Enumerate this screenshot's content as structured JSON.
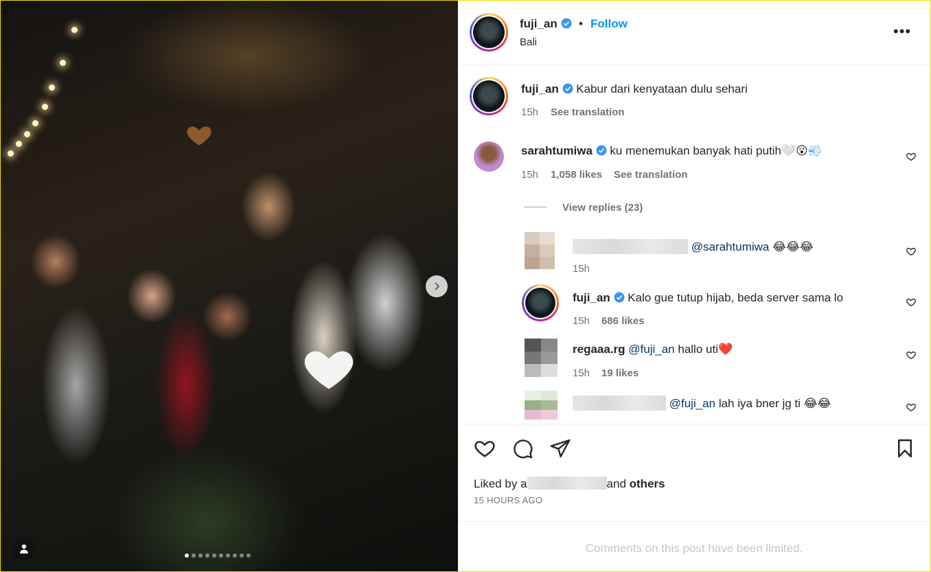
{
  "post": {
    "username": "fuji_an",
    "follow_label": "Follow",
    "separator": "•",
    "location": "Bali",
    "more_label": "•••"
  },
  "caption": {
    "username": "fuji_an",
    "text": "Kabur dari kenyataan dulu sehari",
    "time": "15h",
    "translate": "See translation"
  },
  "comments": [
    {
      "username": "sarahtumiwa",
      "text": "ku menemukan banyak hati putih🤍😮💨",
      "time": "15h",
      "likes": "1,058 likes",
      "translate": "See translation",
      "view_replies": "View replies (23)"
    }
  ],
  "replies": [
    {
      "mention": "@sarahtumiwa",
      "text": "😂😂😂",
      "time": "15h"
    },
    {
      "username": "fuji_an",
      "text": "Kalo gue tutup hijab, beda server sama lo",
      "time": "15h",
      "likes": "686 likes"
    },
    {
      "username": "regaaa.rg",
      "mention": "@fuji_an",
      "text": "hallo uti❤️",
      "time": "15h",
      "likes": "19 likes"
    },
    {
      "mention": "@fuji_an",
      "text": "lah iya bner jg ti 😂😂"
    }
  ],
  "footer": {
    "liked_prefix": "Liked by",
    "liked_partial": "a",
    "liked_mid": "and",
    "liked_others": "others",
    "time_ago": "15 HOURS AGO",
    "limited": "Comments on this post have been limited."
  },
  "carousel": {
    "total_dots": 10,
    "active_index": 0
  },
  "colors": {
    "accent": "#0095f6",
    "mention": "#00376b",
    "meta": "#737373",
    "verified": "#3897f0"
  }
}
